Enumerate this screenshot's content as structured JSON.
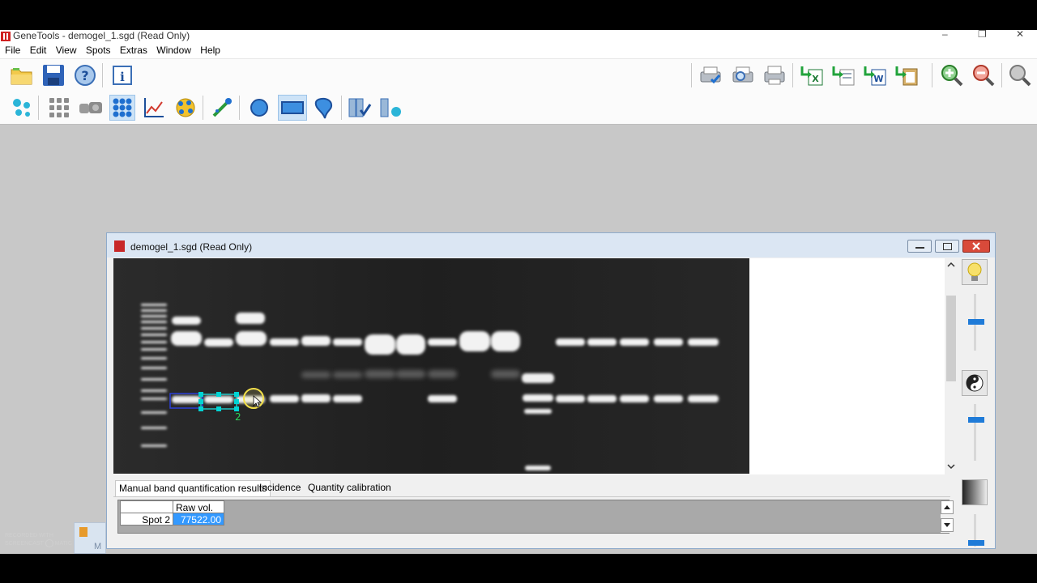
{
  "app": {
    "title": "GeneTools - demogel_1.sgd   (Read Only)",
    "window_controls": {
      "minimize": "–",
      "restore": "❐",
      "close": "✕"
    }
  },
  "menu": [
    "File",
    "Edit",
    "View",
    "Spots",
    "Extras",
    "Window",
    "Help"
  ],
  "toolbar1": {
    "left_icons": [
      "open-folder-icon",
      "save-disk-icon",
      "help-icon",
      "info-icon"
    ],
    "right_icons": [
      "print-preview-check-icon",
      "print-preview-icon",
      "print-icon",
      "export-excel-icon",
      "export-copy-icon",
      "export-word-icon",
      "export-clipboard-icon",
      "zoom-in-icon",
      "zoom-out-icon",
      "zoom-fit-icon"
    ]
  },
  "toolbar2": {
    "icons": [
      "spots-icon",
      "grid-lanes-icon",
      "camera-icon",
      "dot-grid-icon",
      "profile-graph-icon",
      "colony-icon",
      "wand-icon",
      "circle-tool-icon",
      "rectangle-tool-icon",
      "freehand-tool-icon",
      "calibration-check-icon",
      "calibration-icon"
    ]
  },
  "document": {
    "title": "demogel_1.sgd   (Read Only)",
    "spot_label": "2"
  },
  "tabs": [
    {
      "label": "Manual band quantification results",
      "active": true
    },
    {
      "label": "Incidence",
      "active": false
    },
    {
      "label": "Quantity calibration",
      "active": false
    }
  ],
  "results": {
    "column_header": "Raw vol.",
    "rows": [
      {
        "name": "Spot 2",
        "value": "77522.00"
      }
    ]
  },
  "taskbar": {
    "label": "M"
  },
  "watermark": {
    "line1": "RECORDED WITH",
    "line2": "SCREENCAST",
    "line3": "MATIC"
  },
  "colors": {
    "accent": "#1f6fcf",
    "selection": "#3399ff",
    "spot_handle": "#00d4d4",
    "cursor_ring": "#f3e04a",
    "close_button": "#d94a3a"
  }
}
